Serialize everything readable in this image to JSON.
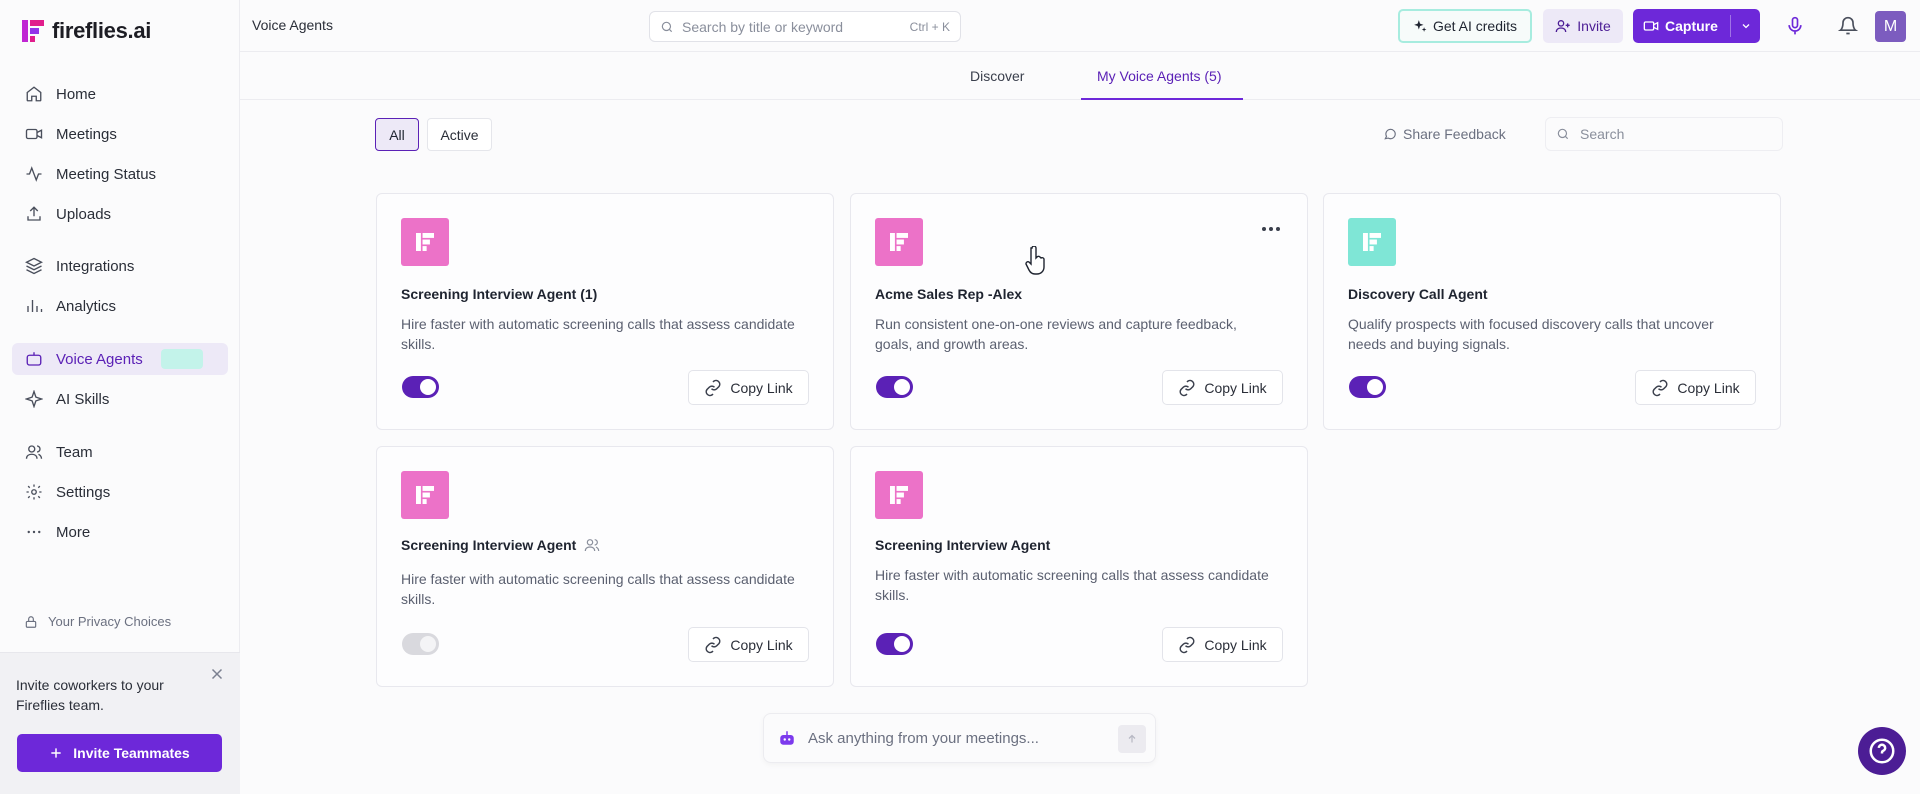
{
  "app": {
    "logo_text": "fireflies.ai"
  },
  "sidebar": {
    "items": [
      {
        "label": "Home",
        "icon": "home-icon"
      },
      {
        "label": "Meetings",
        "icon": "video-icon"
      },
      {
        "label": "Meeting Status",
        "icon": "activity-icon"
      },
      {
        "label": "Uploads",
        "icon": "upload-icon"
      },
      {
        "label": "Integrations",
        "icon": "layers-icon"
      },
      {
        "label": "Analytics",
        "icon": "bar-chart-icon"
      },
      {
        "label": "Voice Agents",
        "icon": "bot-icon",
        "active": true
      },
      {
        "label": "AI Skills",
        "icon": "sparkle-icon"
      },
      {
        "label": "Team",
        "icon": "users-icon"
      },
      {
        "label": "Settings",
        "icon": "gear-icon"
      },
      {
        "label": "More",
        "icon": "dots-icon"
      }
    ],
    "privacy_label": "Your Privacy Choices",
    "invite": {
      "message": "Invite coworkers to your Fireflies team.",
      "button_label": "Invite Teammates"
    }
  },
  "header": {
    "page_title": "Voice Agents",
    "search_placeholder": "Search by title or keyword",
    "search_shortcut": "Ctrl + K",
    "credits_label": "Get AI credits",
    "invite_label": "Invite",
    "capture_label": "Capture",
    "avatar_initial": "M"
  },
  "tabs": [
    {
      "label": "Discover",
      "active": false
    },
    {
      "label": "My Voice Agents (5)",
      "active": true
    }
  ],
  "filters": {
    "all_label": "All",
    "active_label": "Active",
    "feedback_label": "Share Feedback",
    "search_placeholder": "Search"
  },
  "agents": [
    {
      "name": "Screening Interview Agent (1)",
      "description": "Hire faster with automatic screening calls that assess candidate skills.",
      "enabled": true,
      "tile_color": "#ec72c8",
      "copy_label": "Copy Link"
    },
    {
      "name": "Acme Sales Rep -Alex",
      "description": "Run consistent one-on-one reviews and capture feedback, goals, and growth areas.",
      "enabled": true,
      "tile_color": "#ec72c8",
      "copy_label": "Copy Link"
    },
    {
      "name": "Discovery Call Agent",
      "description": "Qualify prospects with focused discovery calls that uncover needs and buying signals.",
      "enabled": true,
      "tile_color": "#7fe6d6",
      "copy_label": "Copy Link"
    },
    {
      "name": "Screening Interview Agent",
      "description": "Hire faster with automatic screening calls that assess candidate skills.",
      "enabled": false,
      "shared": true,
      "tile_color": "#ec72c8",
      "copy_label": "Copy Link"
    },
    {
      "name": "Screening Interview Agent",
      "description": "Hire faster with automatic screening calls that assess candidate skills.",
      "enabled": true,
      "tile_color": "#ec72c8",
      "copy_label": "Copy Link"
    }
  ],
  "ask_bar": {
    "placeholder": "Ask anything from your meetings..."
  },
  "colors": {
    "accent": "#6d28d9",
    "accent_light": "#ede9f7",
    "teal": "#a7ecdf"
  }
}
